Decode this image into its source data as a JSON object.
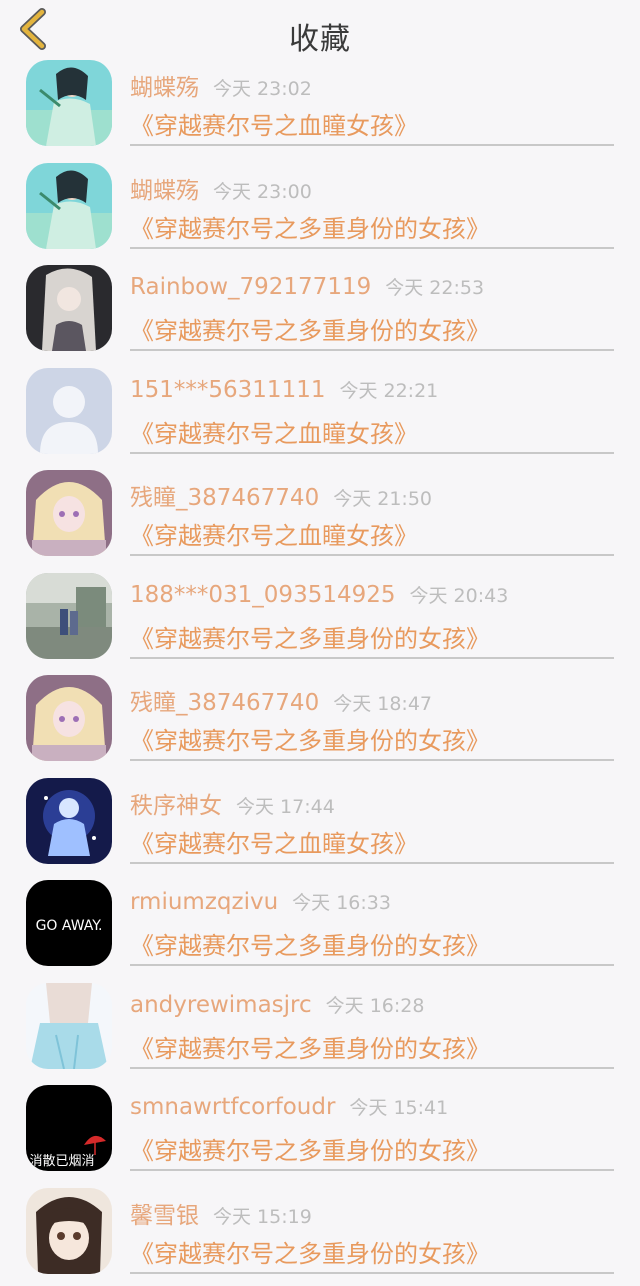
{
  "header": {
    "title": "收藏",
    "back_icon": "chevron-left-icon",
    "accent_color": "#e3b43e"
  },
  "colors": {
    "name": "#e7a77c",
    "book": "#e89a5e",
    "time": "#bdbdbd"
  },
  "items": [
    {
      "name": "蝴蝶殇",
      "time": "今天 23:02",
      "book": "《穿越赛尔号之血瞳女孩》",
      "avatar": "teal-warrior-girl"
    },
    {
      "name": "蝴蝶殇",
      "time": "今天 23:00",
      "book": "《穿越赛尔号之多重身份的女孩》",
      "avatar": "teal-warrior-girl"
    },
    {
      "name": "Rainbow_792177119",
      "time": "今天 22:53",
      "book": "《穿越赛尔号之多重身份的女孩》",
      "avatar": "silver-hair-dark"
    },
    {
      "name": "151***56311111",
      "time": "今天 22:21",
      "book": "《穿越赛尔号之血瞳女孩》",
      "avatar": "default-person"
    },
    {
      "name": "残瞳_387467740",
      "time": "今天 21:50",
      "book": "《穿越赛尔号之血瞳女孩》",
      "avatar": "blonde-anime-girl"
    },
    {
      "name": "188***031_093514925",
      "time": "今天 20:43",
      "book": "《穿越赛尔号之多重身份的女孩》",
      "avatar": "street-photo"
    },
    {
      "name": "残瞳_387467740",
      "time": "今天 18:47",
      "book": "《穿越赛尔号之多重身份的女孩》",
      "avatar": "blonde-anime-girl"
    },
    {
      "name": "秩序神女",
      "time": "今天 17:44",
      "book": "《穿越赛尔号之血瞳女孩》",
      "avatar": "blue-magic-girl"
    },
    {
      "name": "rmiumzqzivu",
      "time": "今天 16:33",
      "book": "《穿越赛尔号之多重身份的女孩》",
      "avatar": "go-away-text",
      "avatar_text": "GO AWAY."
    },
    {
      "name": "andyrewimasjrc",
      "time": "今天 16:28",
      "book": "《穿越赛尔号之多重身份的女孩》",
      "avatar": "blue-skirt-girl"
    },
    {
      "name": "smnawrtfcorfoudr",
      "time": "今天 15:41",
      "book": "《穿越赛尔号之多重身份的女孩》",
      "avatar": "black-umbrella",
      "avatar_text": "消散已烟消"
    },
    {
      "name": "馨雪银",
      "time": "今天 15:19",
      "book": "《穿越赛尔号之多重身份的女孩》",
      "avatar": "doll-face-girl"
    }
  ]
}
